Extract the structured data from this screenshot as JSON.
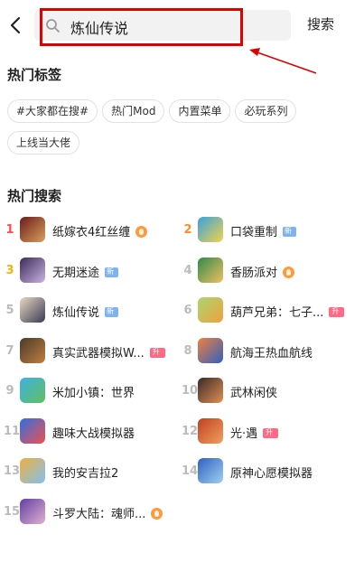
{
  "search": {
    "query": "炼仙传说",
    "button_label": "搜索"
  },
  "hot_tags": {
    "title": "热门标签",
    "tags": [
      "#大家都在搜#",
      "热门Mod",
      "内置菜单",
      "必玩系列",
      "上线当大佬"
    ]
  },
  "hot_search": {
    "title": "热门搜索",
    "items": [
      {
        "rank": "1",
        "name": "纸嫁衣4红丝缠",
        "badge": "hot"
      },
      {
        "rank": "2",
        "name": "口袋重制",
        "badge": "new"
      },
      {
        "rank": "3",
        "name": "无期迷途",
        "badge": "new"
      },
      {
        "rank": "4",
        "name": "香肠派对",
        "badge": "hot"
      },
      {
        "rank": "5",
        "name": "炼仙传说",
        "badge": "new"
      },
      {
        "rank": "6",
        "name": "葫芦兄弟：七子...",
        "badge": "up"
      },
      {
        "rank": "7",
        "name": "真实武器模拟W...",
        "badge": "up"
      },
      {
        "rank": "8",
        "name": "航海王热血航线",
        "badge": ""
      },
      {
        "rank": "9",
        "name": "米加小镇：世界",
        "badge": ""
      },
      {
        "rank": "10",
        "name": "武林闲侠",
        "badge": ""
      },
      {
        "rank": "11",
        "name": "趣味大战模拟器",
        "badge": ""
      },
      {
        "rank": "12",
        "name": "光·遇",
        "badge": "up"
      },
      {
        "rank": "13",
        "name": "我的安吉拉2",
        "badge": ""
      },
      {
        "rank": "14",
        "name": "原神心愿模拟器",
        "badge": ""
      },
      {
        "rank": "15",
        "name": "斗罗大陆：魂师...",
        "badge": "hot"
      }
    ]
  },
  "colors": {
    "annotation": "#e00000",
    "rank1": "#f55050",
    "rank2": "#ff8a2a",
    "rank3": "#f5b400"
  }
}
